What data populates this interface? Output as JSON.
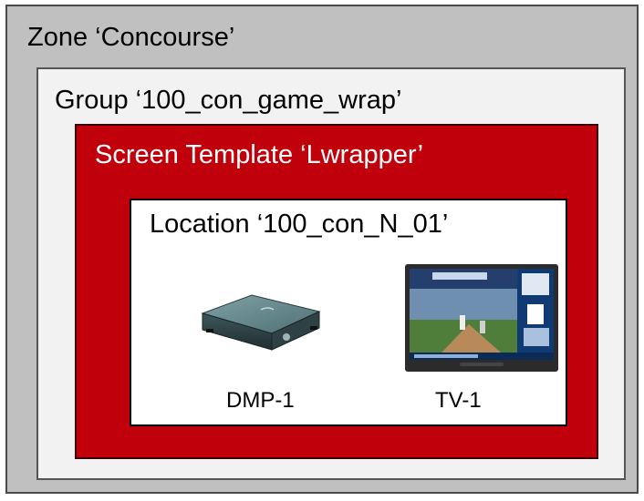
{
  "zone": {
    "title": "Zone ‘Concourse’"
  },
  "group": {
    "title": "Group ‘100_con_game_wrap’"
  },
  "screen_template": {
    "title": "Screen Template ‘Lwrapper’"
  },
  "location": {
    "title": "Location ‘100_con_N_01’",
    "devices": [
      {
        "label": "DMP-1",
        "icon": "media-player-box-icon"
      },
      {
        "label": "TV-1",
        "icon": "television-icon"
      }
    ]
  },
  "colors": {
    "zone_fill": "#c0c0c0",
    "group_fill": "#f2f2f2",
    "template_fill": "#c0000a",
    "location_fill": "#ffffff"
  }
}
